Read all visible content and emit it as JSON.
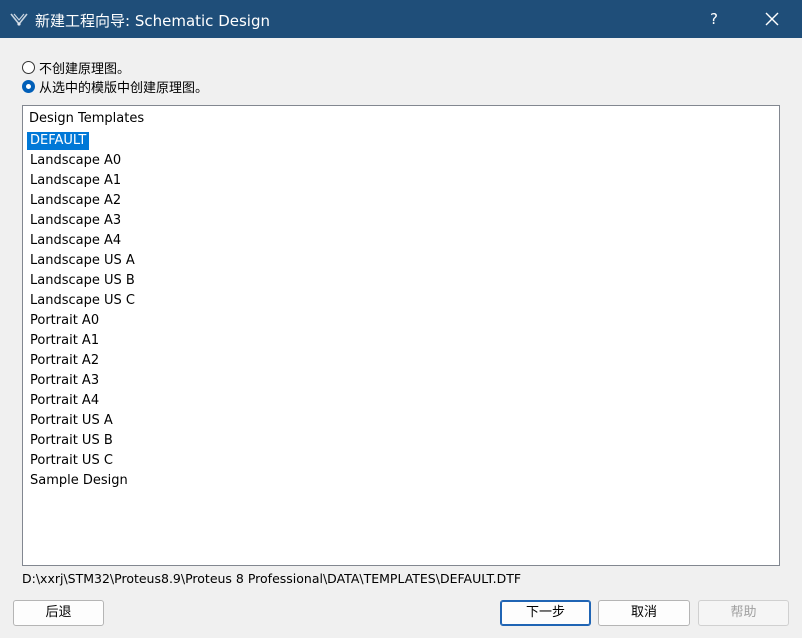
{
  "window": {
    "title": "新建工程向导: Schematic Design",
    "help": "?"
  },
  "options": {
    "no_schematic": "不创建原理图。",
    "from_template": "从选中的模版中创建原理图。",
    "selected": "from_template"
  },
  "templates": {
    "header": "Design Templates",
    "items": [
      "DEFAULT",
      "Landscape A0",
      "Landscape A1",
      "Landscape A2",
      "Landscape A3",
      "Landscape A4",
      "Landscape US A",
      "Landscape US B",
      "Landscape US C",
      "Portrait A0",
      "Portrait A1",
      "Portrait A2",
      "Portrait A3",
      "Portrait A4",
      "Portrait US A",
      "Portrait US B",
      "Portrait US C",
      "Sample Design"
    ],
    "selected": "DEFAULT"
  },
  "path": "D:\\xxrj\\STM32\\Proteus8.9\\Proteus 8 Professional\\DATA\\TEMPLATES\\DEFAULT.DTF",
  "buttons": {
    "back": "后退",
    "next": "下一步",
    "cancel": "取消",
    "help": "帮助"
  }
}
